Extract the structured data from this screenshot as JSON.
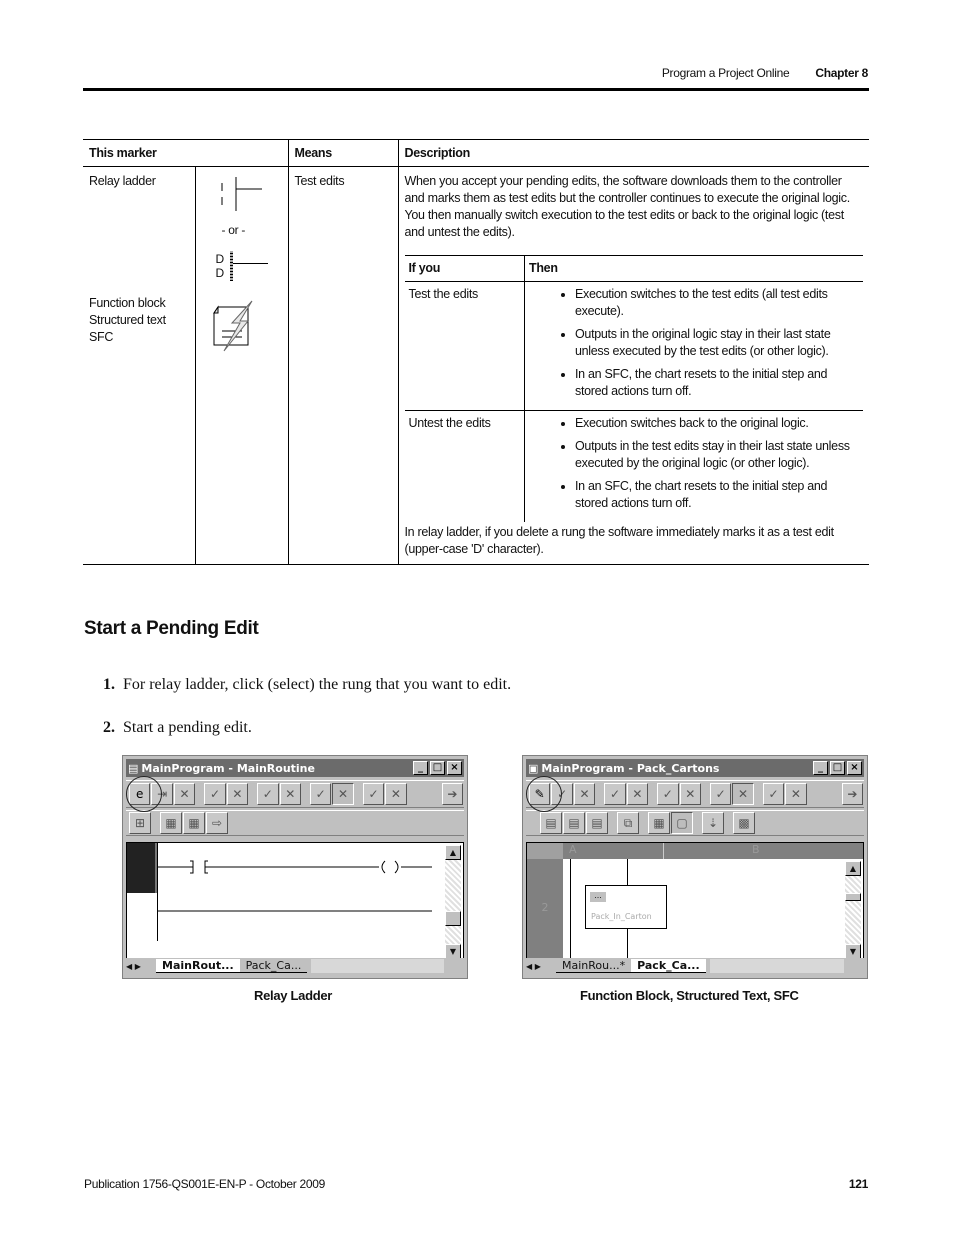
{
  "header": {
    "section": "Program a Project Online",
    "chapter": "Chapter 8"
  },
  "table": {
    "headers": [
      "This marker",
      "Means",
      "Description"
    ],
    "marker_labels": {
      "relay": "Relay ladder",
      "or": "- or -",
      "fb_lines": [
        "Function block",
        "Structured text",
        "SFC"
      ]
    },
    "means": "Test edits",
    "description": "When you accept your pending edits, the software downloads them to the controller and marks them as test edits but the controller continues to execute the original logic. You then manually switch execution to the test edits or back to the original logic (test and untest the edits).",
    "inner": {
      "headers": [
        "If you",
        "Then"
      ],
      "rows": [
        {
          "if": "Test the edits",
          "then": [
            "Execution switches to the test edits (all test edits execute).",
            "Outputs in the original logic stay in their last state unless executed by the test edits (or other logic).",
            "In an SFC, the chart resets to the initial step and stored actions turn off."
          ]
        },
        {
          "if": "Untest the edits",
          "then": [
            "Execution switches back to the original logic.",
            "Outputs in the test edits stay in their last state unless executed by the original logic (or other logic).",
            "In an SFC, the chart resets to the initial step and stored actions turn off."
          ]
        }
      ]
    },
    "note": "In relay ladder, if you delete a rung the software immediately marks it as a test edit (upper-case 'D' character).",
    "d_marker": "D"
  },
  "section_title": "Start a Pending Edit",
  "steps": [
    {
      "num": "1.",
      "text": "For relay ladder, click (select) the rung that you want to edit."
    },
    {
      "num": "2.",
      "text": "Start a pending edit."
    }
  ],
  "screens": {
    "relay": {
      "title": "MainProgram - MainRoutine",
      "tabs": [
        "MainRout...",
        "Pack_Ca..."
      ],
      "caption": "Relay Ladder"
    },
    "fb": {
      "title": "MainProgram - Pack_Cartons",
      "tabs": [
        "MainRou...*",
        "Pack_Ca..."
      ],
      "col_a": "A",
      "col_b": "B",
      "row_num": "2",
      "step_name": "Pack_In_Carton",
      "step_btn": "...",
      "caption": "Function Block, Structured Text, SFC"
    },
    "win_buttons": {
      "min": "_",
      "max": "□",
      "close": "×"
    }
  },
  "footer": {
    "publication": "Publication 1756-QS001E-EN-P - October 2009",
    "page": "121"
  }
}
